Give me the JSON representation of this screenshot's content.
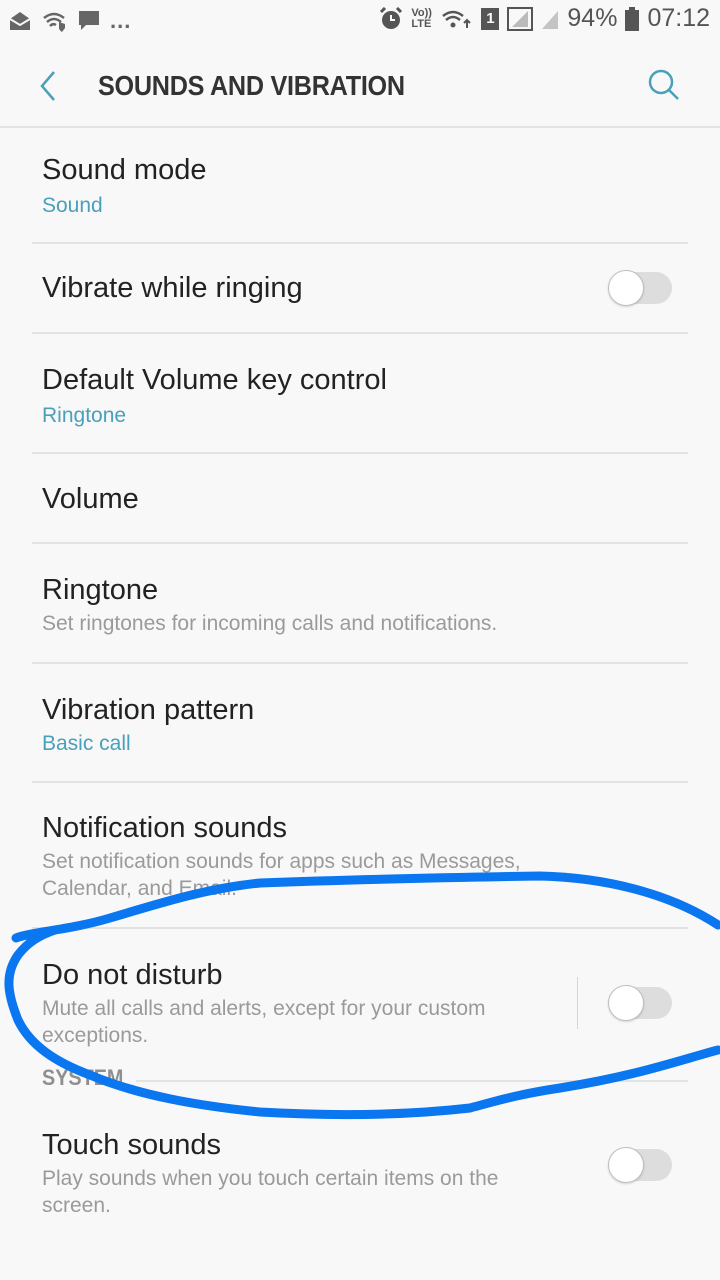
{
  "status_bar": {
    "left_icons": [
      "email-icon",
      "wifi-secure-icon",
      "message-icon",
      "more-notifications-icon"
    ],
    "more_label": "...",
    "right_icons": [
      "alarm-icon",
      "volte-icon",
      "wifi-data-icon",
      "sim-1-icon",
      "signal-icon",
      "signal-2-icon",
      "battery-icon"
    ],
    "volte_label": "Vo)) LTE",
    "sim_label": "1",
    "battery": "94%",
    "time": "07:12"
  },
  "app_bar": {
    "title": "SOUNDS AND VIBRATION",
    "accent_color": "#4a9fba"
  },
  "settings": [
    {
      "title": "Sound mode",
      "value": "Sound"
    },
    {
      "title": "Vibrate while ringing",
      "toggle": false
    },
    {
      "title": "Default Volume key control",
      "value": "Ringtone"
    },
    {
      "title": "Volume"
    },
    {
      "title": "Ringtone",
      "description": "Set ringtones for incoming calls and notifications."
    },
    {
      "title": "Vibration pattern",
      "value": "Basic call"
    },
    {
      "title": "Notification sounds",
      "description": "Set notification sounds for apps such as Messages, Calendar, and Email."
    },
    {
      "title": "Do not disturb",
      "description": "Mute all calls and alerts, except for your custom exceptions.",
      "toggle": false
    }
  ],
  "system_section": {
    "label": "SYSTEM",
    "items": [
      {
        "title": "Touch sounds",
        "description": "Play sounds when you touch certain items on the screen.",
        "toggle": false
      }
    ]
  },
  "annotation": {
    "type": "hand-drawn circle",
    "target": "Do not disturb",
    "color": "#0a76f0"
  }
}
